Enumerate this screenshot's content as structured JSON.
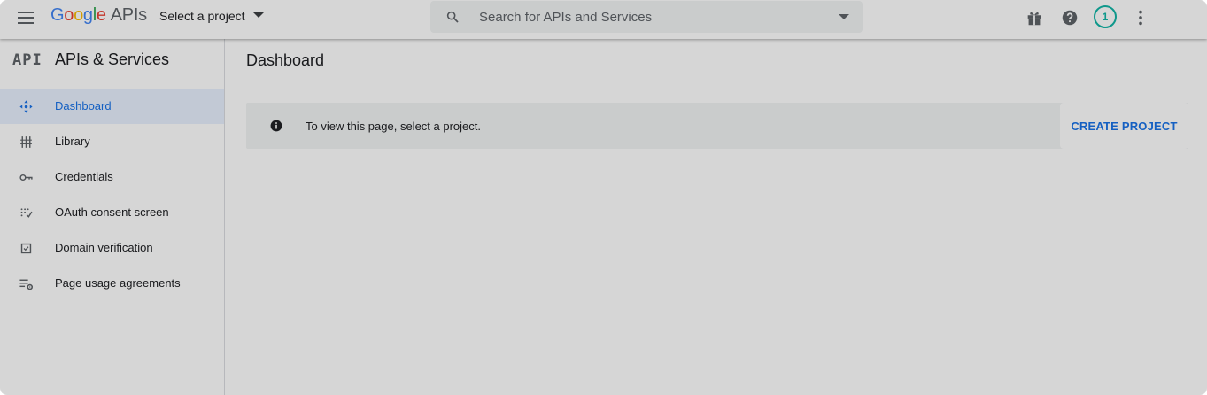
{
  "topbar": {
    "logo_google": [
      "G",
      "o",
      "o",
      "g",
      "l",
      "e"
    ],
    "logo_apis": "APIs",
    "project_selector": "Select a project",
    "search_placeholder": "Search for APIs and Services",
    "notification_count": "1",
    "icons": [
      "menu-icon",
      "search-icon",
      "gift-icon",
      "help-icon",
      "more-vert-icon"
    ]
  },
  "sidebar": {
    "logo": "API",
    "title": "APIs & Services",
    "items": [
      {
        "label": "Dashboard",
        "icon": "dashboard-icon",
        "active": true
      },
      {
        "label": "Library",
        "icon": "library-icon",
        "active": false
      },
      {
        "label": "Credentials",
        "icon": "key-icon",
        "active": false
      },
      {
        "label": "OAuth consent screen",
        "icon": "oauth-consent-icon",
        "active": false
      },
      {
        "label": "Domain verification",
        "icon": "checkbox-icon",
        "active": false
      },
      {
        "label": "Page usage agreements",
        "icon": "list-settings-icon",
        "active": false
      }
    ]
  },
  "main": {
    "title": "Dashboard",
    "banner_text": "To view this page, select a project.",
    "create_button": "CREATE PROJECT"
  },
  "colors": {
    "accent": "#1a73e8",
    "active_bg": "#e8f0fe",
    "banner_bg": "#f1f3f4",
    "badge": "#12b5a6"
  }
}
